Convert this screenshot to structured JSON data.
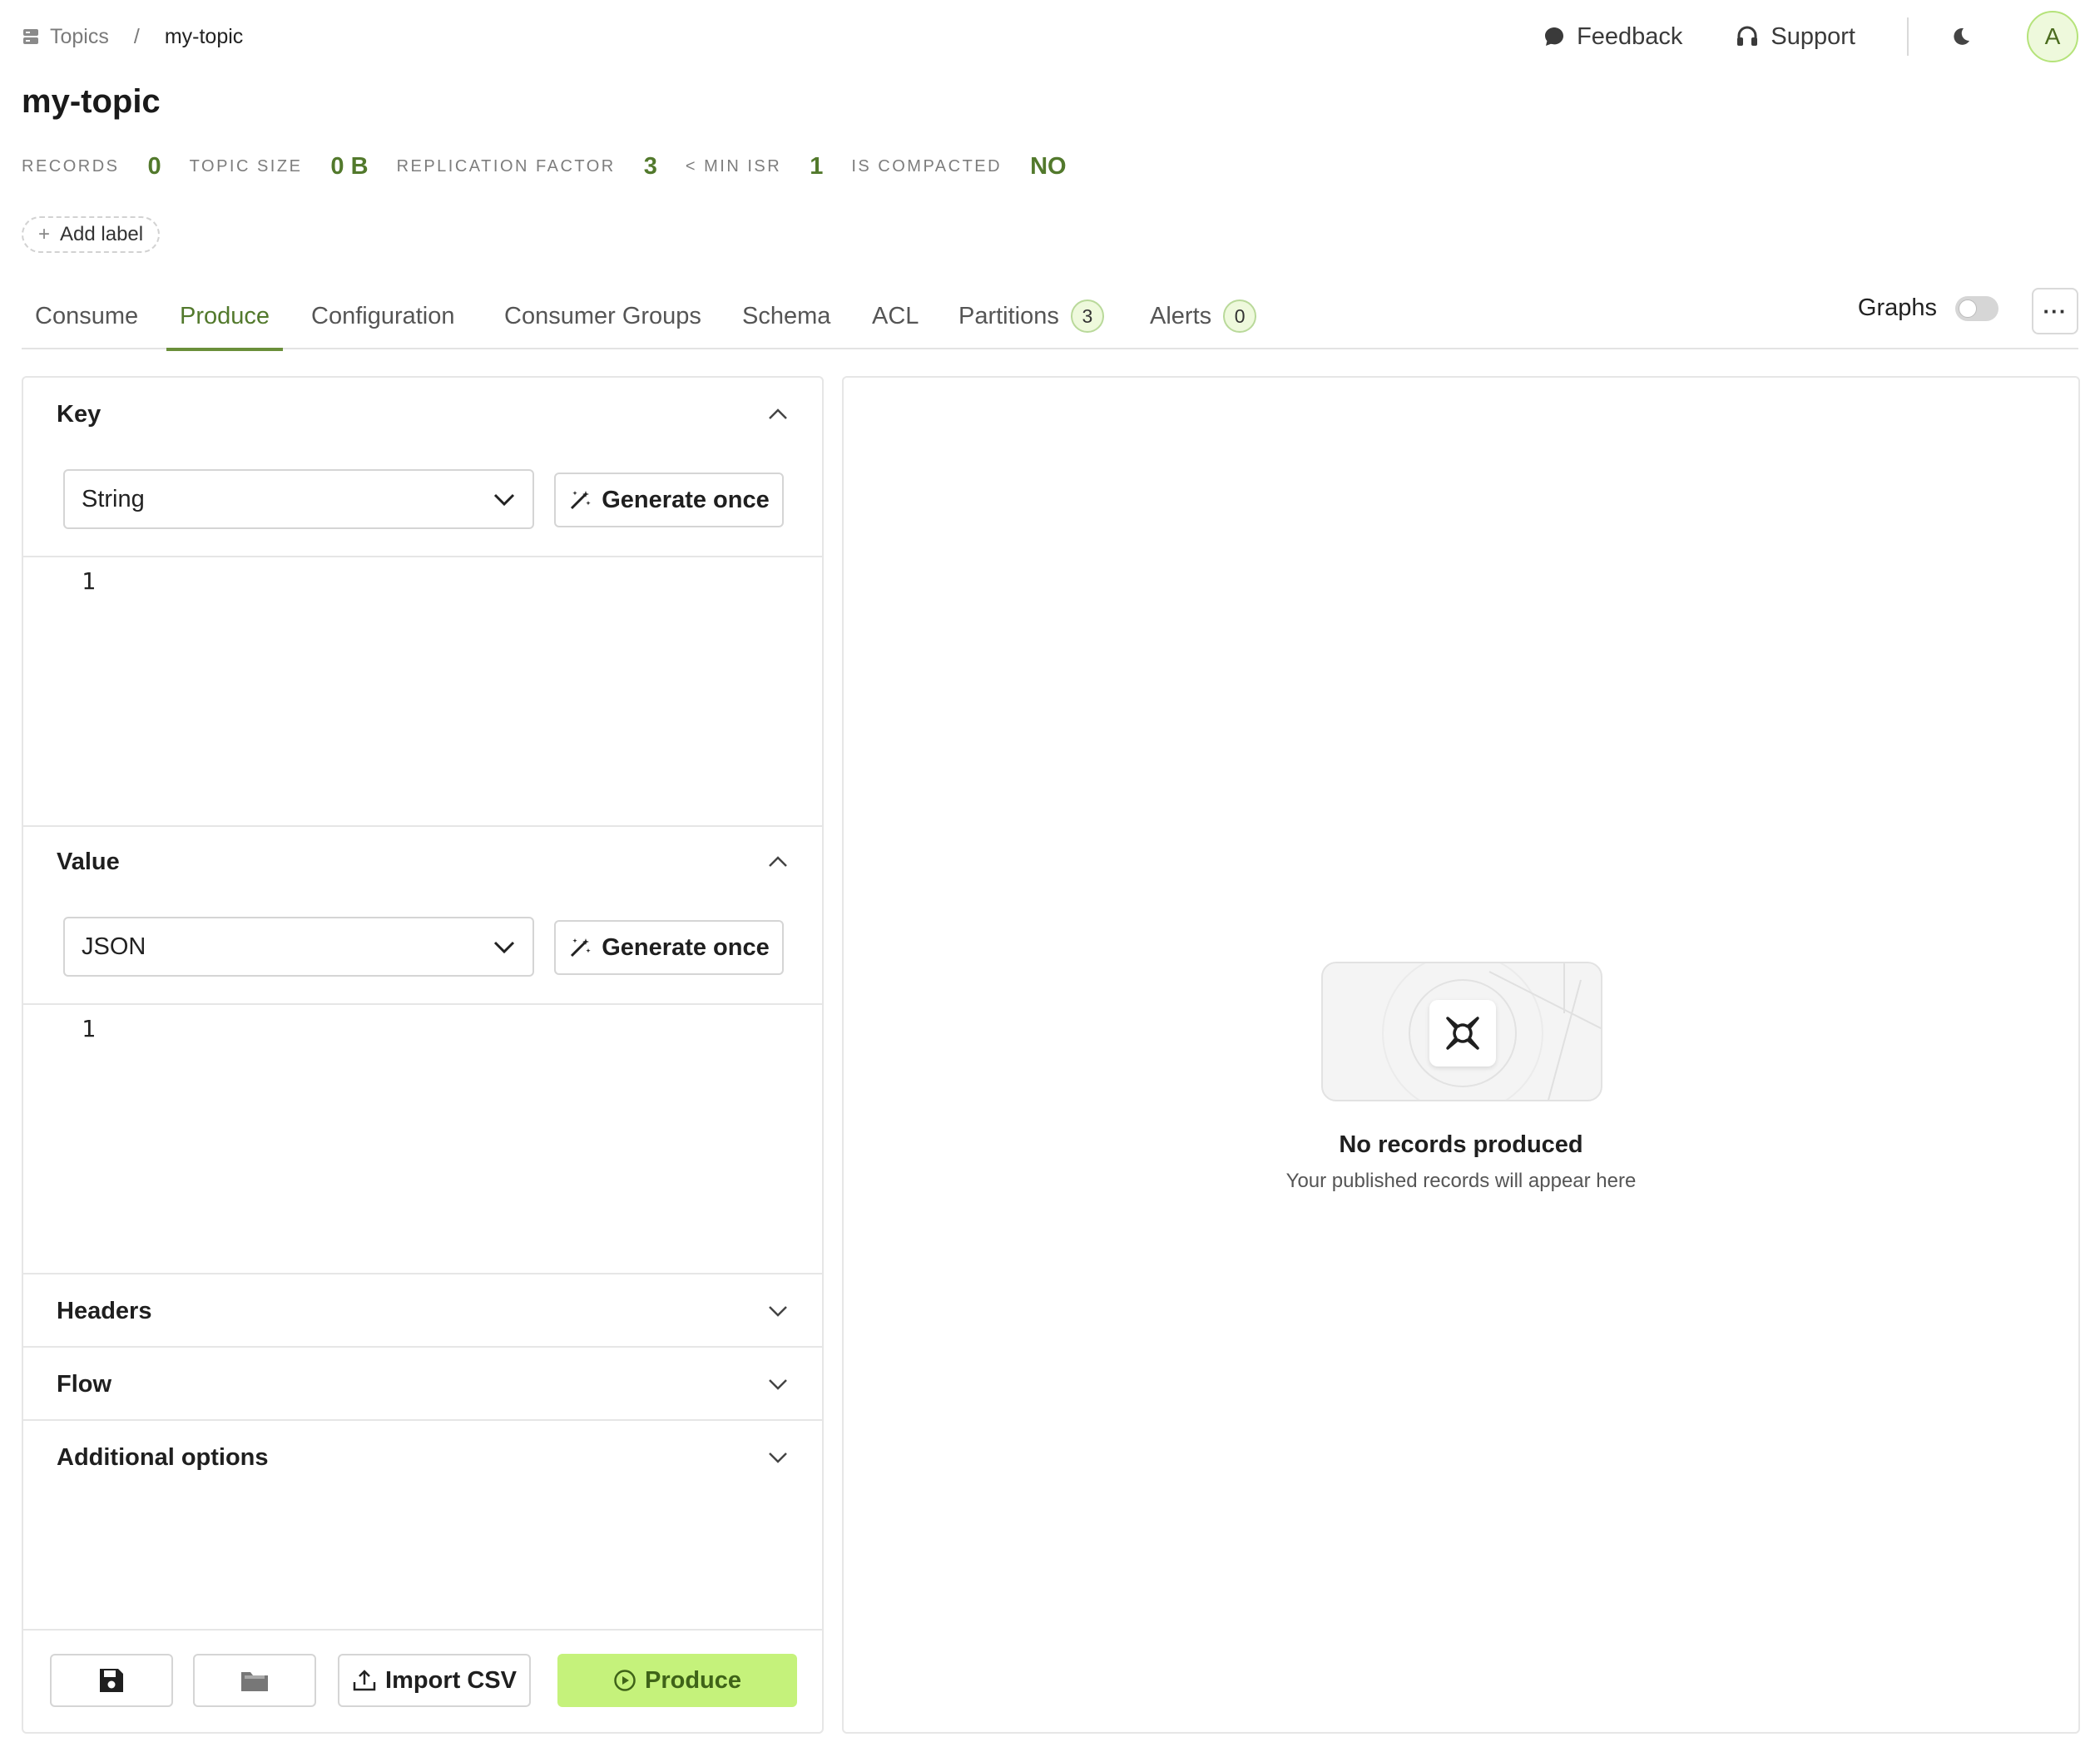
{
  "breadcrumb": {
    "root": "Topics",
    "separator": "/",
    "current": "my-topic"
  },
  "top_actions": {
    "feedback": "Feedback",
    "support": "Support",
    "avatar_initial": "A"
  },
  "title": "my-topic",
  "stats": [
    {
      "label": "RECORDS",
      "value": "0"
    },
    {
      "label": "TOPIC SIZE",
      "value": "0 B"
    },
    {
      "label": "REPLICATION FACTOR",
      "value": "3"
    },
    {
      "label": "< MIN ISR",
      "value": "1"
    },
    {
      "label": "IS COMPACTED",
      "value": "NO"
    }
  ],
  "add_label": "Add label",
  "tabs": {
    "consume": "Consume",
    "produce": "Produce",
    "configuration": "Configuration",
    "consumer_groups": "Consumer Groups",
    "schema": "Schema",
    "acl": "ACL",
    "partitions": "Partitions",
    "partitions_count": "3",
    "alerts": "Alerts",
    "alerts_count": "0",
    "active": "Produce"
  },
  "graphs": {
    "label": "Graphs",
    "enabled": false
  },
  "more_label": "···",
  "key_section": {
    "title": "Key",
    "format": "String",
    "generate": "Generate once",
    "line_number": "1"
  },
  "value_section": {
    "title": "Value",
    "format": "JSON",
    "generate": "Generate once",
    "line_number": "1"
  },
  "headers_title": "Headers",
  "flow_title": "Flow",
  "additional_title": "Additional options",
  "buttons": {
    "import_csv": "Import CSV",
    "produce": "Produce"
  },
  "empty_state": {
    "title": "No records produced",
    "subtitle": "Your published records will appear here"
  },
  "colors": {
    "accent": "#52792c",
    "produce_button": "#c5f27b",
    "badge_bg": "#eef9dc"
  },
  "icons": [
    "topics-icon",
    "feedback-icon",
    "support-icon",
    "moon-icon",
    "chevron-up-icon",
    "chevron-down-icon",
    "magic-wand-icon",
    "save-icon",
    "folder-icon",
    "upload-icon",
    "play-icon",
    "empty-records-icon"
  ]
}
